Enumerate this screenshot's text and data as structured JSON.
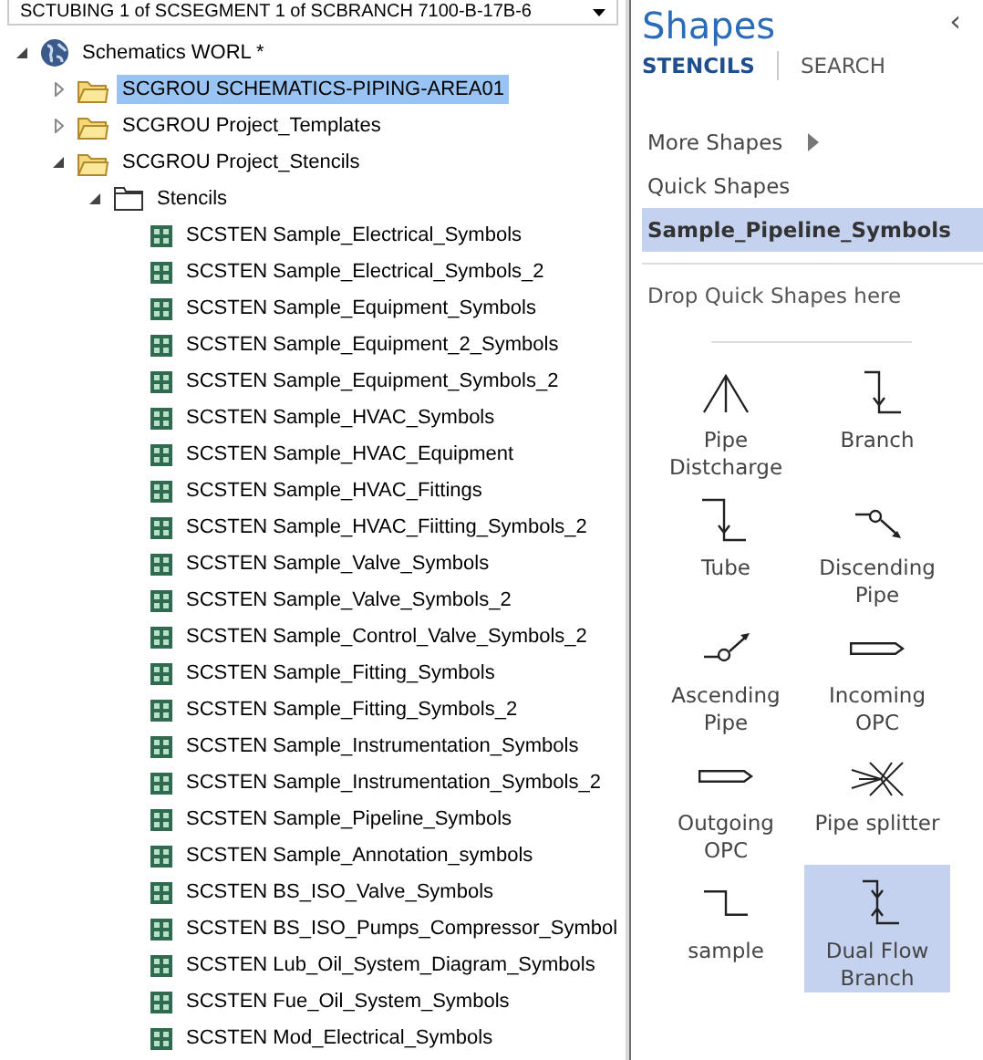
{
  "combo": {
    "value": "SCTUBING 1 of SCSEGMENT 1 of SCBRANCH 7100-B-17B-6"
  },
  "tree": [
    {
      "label": "Schematics WORL *",
      "expanded": true,
      "selected": false,
      "children": [
        {
          "label": "SCGROU SCHEMATICS-PIPING-AREA01",
          "expanded": false,
          "selected": true
        },
        {
          "label": "SCGROU Project_Templates",
          "expanded": false,
          "selected": false
        },
        {
          "label": "SCGROU Project_Stencils",
          "expanded": true,
          "selected": false,
          "children": [
            {
              "label": "Stencils",
              "expanded": true,
              "selected": false,
              "children": [
                {
                  "label": "SCSTEN Sample_Electrical_Symbols",
                  "selected": false
                },
                {
                  "label": "SCSTEN Sample_Electrical_Symbols_2",
                  "selected": false
                },
                {
                  "label": "SCSTEN Sample_Equipment_Symbols",
                  "selected": false
                },
                {
                  "label": "SCSTEN Sample_Equipment_2_Symbols",
                  "selected": false
                },
                {
                  "label": "SCSTEN Sample_Equipment_Symbols_2",
                  "selected": false
                },
                {
                  "label": "SCSTEN Sample_HVAC_Symbols",
                  "selected": false
                },
                {
                  "label": "SCSTEN Sample_HVAC_Equipment",
                  "selected": false
                },
                {
                  "label": "SCSTEN Sample_HVAC_Fittings",
                  "selected": false
                },
                {
                  "label": "SCSTEN Sample_HVAC_Fiitting_Symbols_2",
                  "selected": false
                },
                {
                  "label": "SCSTEN Sample_Valve_Symbols",
                  "selected": false
                },
                {
                  "label": "SCSTEN Sample_Valve_Symbols_2",
                  "selected": false
                },
                {
                  "label": "SCSTEN Sample_Control_Valve_Symbols_2",
                  "selected": false
                },
                {
                  "label": "SCSTEN Sample_Fitting_Symbols",
                  "selected": false
                },
                {
                  "label": "SCSTEN Sample_Fitting_Symbols_2",
                  "selected": false
                },
                {
                  "label": "SCSTEN Sample_Instrumentation_Symbols",
                  "selected": false
                },
                {
                  "label": "SCSTEN Sample_Instrumentation_Symbols_2",
                  "selected": false
                },
                {
                  "label": "SCSTEN Sample_Pipeline_Symbols",
                  "selected": false
                },
                {
                  "label": "SCSTEN Sample_Annotation_symbols",
                  "selected": false
                },
                {
                  "label": "SCSTEN BS_ISO_Valve_Symbols",
                  "selected": false
                },
                {
                  "label": "SCSTEN BS_ISO_Pumps_Compressor_Symbol",
                  "selected": false
                },
                {
                  "label": "SCSTEN Lub_Oil_System_Diagram_Symbols",
                  "selected": false
                },
                {
                  "label": "SCSTEN Fue_Oil_System_Symbols",
                  "selected": false
                },
                {
                  "label": "SCSTEN Mod_Electrical_Symbols",
                  "selected": false
                }
              ]
            }
          ]
        }
      ]
    }
  ],
  "shapes_panel": {
    "title": "Shapes",
    "collapse": "‹",
    "tabs": [
      {
        "label": "STENCILS",
        "selected": true
      },
      {
        "label": "SEARCH",
        "selected": false
      }
    ],
    "menu": [
      {
        "label": "More Shapes",
        "kind": "submenu",
        "selected": false
      },
      {
        "label": "Quick Shapes",
        "kind": "item",
        "selected": false
      },
      {
        "label": "Sample_Pipeline_Symbols",
        "kind": "item",
        "selected": true
      }
    ],
    "drop_hint": "Drop Quick Shapes here",
    "shapes": [
      {
        "label": "Pipe Distcharge",
        "kind": "discharge",
        "selected": false
      },
      {
        "label": "Branch",
        "kind": "branch",
        "selected": false
      },
      {
        "label": "Tube",
        "kind": "tube",
        "selected": false
      },
      {
        "label": "Discending Pipe",
        "kind": "descending",
        "selected": false
      },
      {
        "label": "Ascending Pipe",
        "kind": "ascending",
        "selected": false
      },
      {
        "label": "Incoming OPC",
        "kind": "opc",
        "selected": false
      },
      {
        "label": "Outgoing OPC",
        "kind": "opc",
        "selected": false
      },
      {
        "label": "Pipe splitter",
        "kind": "splitter",
        "selected": false
      },
      {
        "label": "sample",
        "kind": "step",
        "selected": false
      },
      {
        "label": "Dual Flow Branch",
        "kind": "dualflow",
        "selected": true
      }
    ]
  }
}
